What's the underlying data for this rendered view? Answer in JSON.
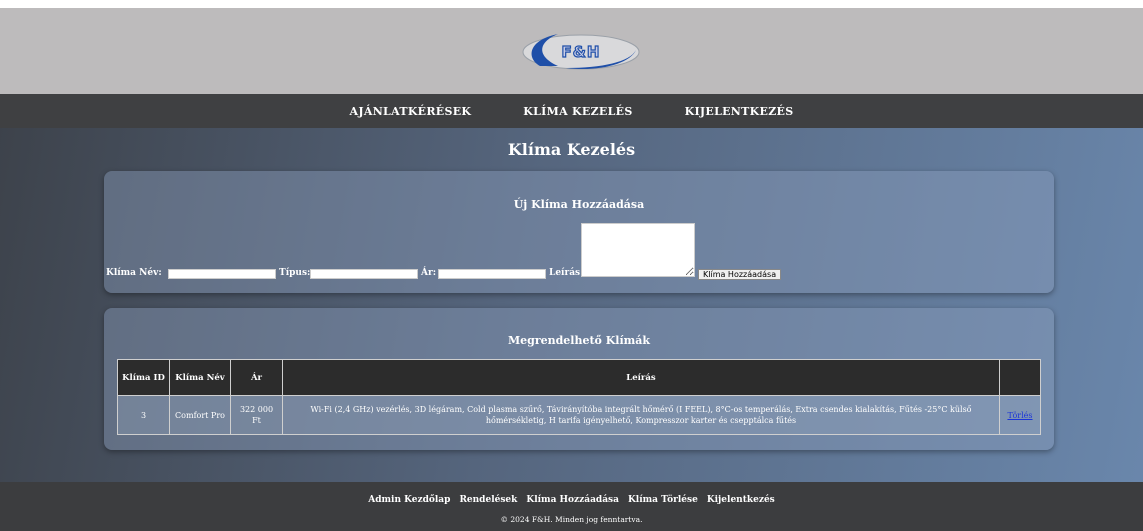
{
  "brand": {
    "logo_text": "F&H",
    "logo_color": "#1f4fa8"
  },
  "nav": {
    "items": [
      {
        "label": "AJÁNLATKÉRÉSEK"
      },
      {
        "label": "KLÍMA KEZELÉS"
      },
      {
        "label": "KIJELENTKEZÉS"
      }
    ]
  },
  "page": {
    "title": "Klíma Kezelés"
  },
  "add_form": {
    "title": "Új Klíma Hozzáadása",
    "name_label": "Klíma Név:",
    "name_value": "",
    "type_label": "Típus:",
    "type_value": "",
    "price_label": "Ár:",
    "price_value": "",
    "desc_label": "Leírás:",
    "desc_value": "",
    "submit_label": "Klíma Hozzáadása"
  },
  "list": {
    "title": "Megrendelhető Klímák",
    "columns": [
      "Klíma ID",
      "Klíma Név",
      "Ár",
      "Leírás",
      ""
    ],
    "rows": [
      {
        "id": "3",
        "name": "Comfort Pro",
        "price": "322 000 Ft",
        "description": "Wi-Fi (2,4 GHz) vezérlés, 3D légáram, Cold plasma szűrő, Távirányítóba integrált hőmérő (I FEEL), 8°C-os temperálás, Extra csendes kialakítás, Fűtés -25°C külső hőmérsékletig, H tarifa igényelhető, Kompresszor karter és csepptálca fűtés",
        "action": "Törlés"
      }
    ]
  },
  "footer": {
    "links": [
      {
        "label": "Admin Kezdőlap"
      },
      {
        "label": "Rendelések"
      },
      {
        "label": "Klíma Hozzáadása"
      },
      {
        "label": "Klíma Törlése"
      },
      {
        "label": "Kijelentkezés"
      }
    ],
    "copyright": "© 2024 F&H. Minden jog fenntartva."
  }
}
